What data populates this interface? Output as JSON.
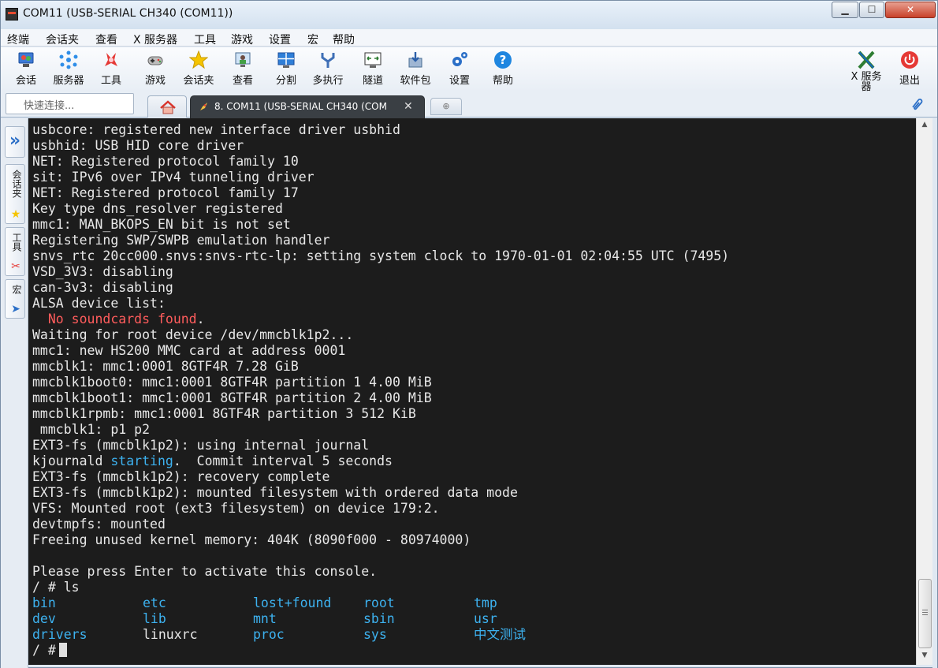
{
  "window": {
    "title": "COM11  (USB-SERIAL CH340 (COM11))"
  },
  "menu": [
    "终端",
    "会话夹",
    "查看",
    "X 服务器",
    "工具",
    "游戏",
    "设置",
    "宏",
    "帮助"
  ],
  "toolbar": [
    {
      "label": "会话",
      "icon": "session-icon"
    },
    {
      "label": "服务器",
      "icon": "servers-icon"
    },
    {
      "label": "工具",
      "icon": "tools-icon"
    },
    {
      "label": "游戏",
      "icon": "games-icon"
    },
    {
      "label": "会话夹",
      "icon": "star-icon"
    },
    {
      "label": "查看",
      "icon": "view-icon"
    },
    {
      "label": "分割",
      "icon": "split-icon"
    },
    {
      "label": "多执行",
      "icon": "multiexec-icon"
    },
    {
      "label": "隧道",
      "icon": "tunnel-icon"
    },
    {
      "label": "软件包",
      "icon": "packages-icon"
    },
    {
      "label": "设置",
      "icon": "settings-icon"
    },
    {
      "label": "帮助",
      "icon": "help-icon"
    }
  ],
  "toolbar_right": [
    {
      "label": "X 服务器",
      "icon": "x-server-icon"
    },
    {
      "label": "退出",
      "icon": "power-icon"
    }
  ],
  "quick_connect": {
    "placeholder": "快速连接..."
  },
  "tab": {
    "label": "8. COM11  (USB-SERIAL CH340 (COM",
    "close": "✕"
  },
  "sidebar": {
    "sessions": "会话夹",
    "tools": "工具",
    "macros": "宏"
  },
  "terminal": {
    "lines": [
      [
        {
          "t": "usbcore: registered new interface driver usbhid",
          "c": ""
        }
      ],
      [
        {
          "t": "usbhid: USB HID core driver",
          "c": ""
        }
      ],
      [
        {
          "t": "NET: Registered protocol family 10",
          "c": ""
        }
      ],
      [
        {
          "t": "sit: IPv6 over IPv4 tunneling driver",
          "c": ""
        }
      ],
      [
        {
          "t": "NET: Registered protocol family 17",
          "c": ""
        }
      ],
      [
        {
          "t": "Key type dns_resolver registered",
          "c": ""
        }
      ],
      [
        {
          "t": "mmc1: MAN_BKOPS_EN bit is not set",
          "c": ""
        }
      ],
      [
        {
          "t": "Registering SWP/SWPB emulation handler",
          "c": ""
        }
      ],
      [
        {
          "t": "snvs_rtc 20cc000.snvs:snvs-rtc-lp: setting system clock to 1970-01-01 02:04:55 UTC (7495)",
          "c": ""
        }
      ],
      [
        {
          "t": "VSD_3V3: disabling",
          "c": ""
        }
      ],
      [
        {
          "t": "can-3v3: disabling",
          "c": ""
        }
      ],
      [
        {
          "t": "ALSA device list:",
          "c": ""
        }
      ],
      [
        {
          "t": "  ",
          "c": ""
        },
        {
          "t": "No soundcards found",
          "c": "red"
        },
        {
          "t": ".",
          "c": ""
        }
      ],
      [
        {
          "t": "Waiting for root device /dev/mmcblk1p2...",
          "c": ""
        }
      ],
      [
        {
          "t": "mmc1: new HS200 MMC card at address 0001",
          "c": ""
        }
      ],
      [
        {
          "t": "mmcblk1: mmc1:0001 8GTF4R 7.28 GiB",
          "c": ""
        }
      ],
      [
        {
          "t": "mmcblk1boot0: mmc1:0001 8GTF4R partition 1 4.00 MiB",
          "c": ""
        }
      ],
      [
        {
          "t": "mmcblk1boot1: mmc1:0001 8GTF4R partition 2 4.00 MiB",
          "c": ""
        }
      ],
      [
        {
          "t": "mmcblk1rpmb: mmc1:0001 8GTF4R partition 3 512 KiB",
          "c": ""
        }
      ],
      [
        {
          "t": " mmcblk1: p1 p2",
          "c": ""
        }
      ],
      [
        {
          "t": "EXT3-fs (mmcblk1p2): using internal journal",
          "c": ""
        }
      ],
      [
        {
          "t": "kjournald ",
          "c": ""
        },
        {
          "t": "starting",
          "c": "cyan"
        },
        {
          "t": ".  Commit interval 5 seconds",
          "c": ""
        }
      ],
      [
        {
          "t": "EXT3-fs (mmcblk1p2): recovery complete",
          "c": ""
        }
      ],
      [
        {
          "t": "EXT3-fs (mmcblk1p2): mounted filesystem with ordered data mode",
          "c": ""
        }
      ],
      [
        {
          "t": "VFS: Mounted root (ext3 filesystem) on device 179:2.",
          "c": ""
        }
      ],
      [
        {
          "t": "devtmpfs: mounted",
          "c": ""
        }
      ],
      [
        {
          "t": "Freeing unused kernel memory: 404K (8090f000 - 80974000)",
          "c": ""
        }
      ],
      [
        {
          "t": "",
          "c": ""
        }
      ],
      [
        {
          "t": "Please press Enter to activate this console.",
          "c": ""
        }
      ],
      [
        {
          "t": "/ # ls",
          "c": ""
        }
      ]
    ],
    "ls_rows": [
      [
        {
          "t": "bin",
          "c": "cyan"
        },
        {
          "t": "etc",
          "c": "cyan"
        },
        {
          "t": "lost+found",
          "c": "cyan"
        },
        {
          "t": "root",
          "c": "cyan"
        },
        {
          "t": "tmp",
          "c": "cyan"
        }
      ],
      [
        {
          "t": "dev",
          "c": "cyan"
        },
        {
          "t": "lib",
          "c": "cyan"
        },
        {
          "t": "mnt",
          "c": "cyan"
        },
        {
          "t": "sbin",
          "c": "cyan"
        },
        {
          "t": "usr",
          "c": "cyan"
        }
      ],
      [
        {
          "t": "drivers",
          "c": "cyan"
        },
        {
          "t": "linuxrc",
          "c": ""
        },
        {
          "t": "proc",
          "c": "cyan"
        },
        {
          "t": "sys",
          "c": "cyan"
        },
        {
          "t": "中文测试",
          "c": "cyan"
        }
      ]
    ],
    "prompt": "/ #"
  },
  "colors": {
    "terminal_bg": "#1c1c1c",
    "text": "#e8e8e8",
    "red": "#ff5c5c",
    "cyan": "#3db2f0"
  }
}
